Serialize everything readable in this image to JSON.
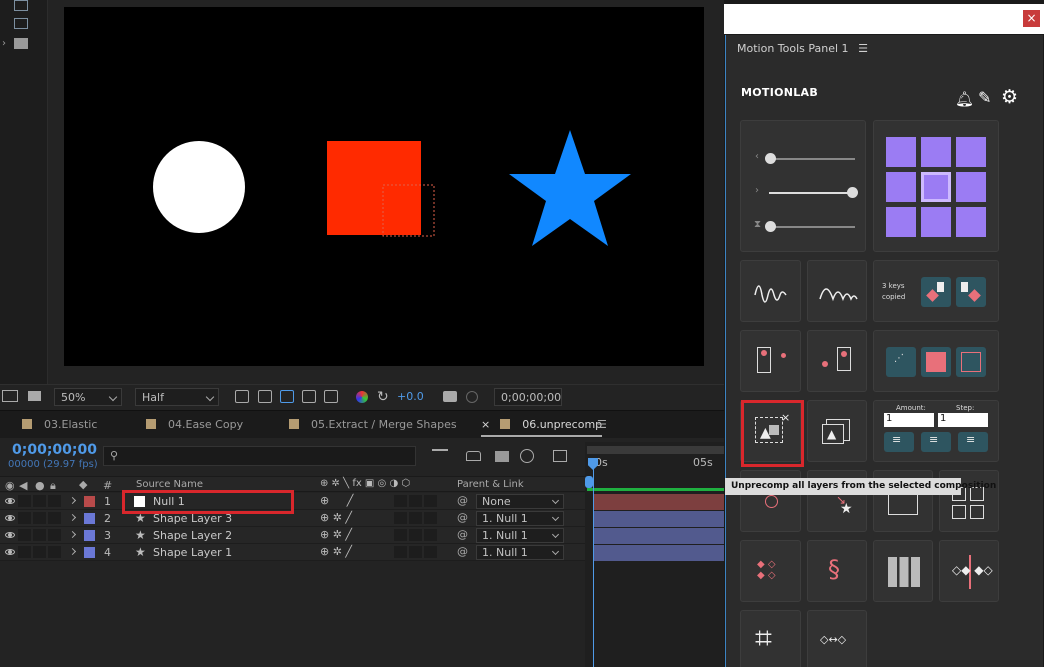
{
  "viewer": {
    "zoom": "50%",
    "resolution": "Half",
    "exposure": "+0.0",
    "timecode": "0;00;00;00"
  },
  "tabs": [
    {
      "label": "03.Elastic"
    },
    {
      "label": "04.Ease Copy"
    },
    {
      "label": "05.Extract / Merge Shapes"
    },
    {
      "label": "06.unprecomp",
      "active": true
    }
  ],
  "timeline": {
    "timecode": "0;00;00;00",
    "frames": "00000 (29.97 fps)",
    "search_placeholder": "",
    "columns": {
      "number": "#",
      "source_name": "Source Name",
      "parent": "Parent & Link"
    },
    "ruler": {
      "start": "0s",
      "end": "05s"
    },
    "layers": [
      {
        "num": "1",
        "name": "Null 1",
        "color": "#b84a4a",
        "parent": "None",
        "type": "null"
      },
      {
        "num": "2",
        "name": "Shape Layer 3",
        "color": "#6b78d6",
        "parent": "1. Null 1",
        "type": "shape"
      },
      {
        "num": "3",
        "name": "Shape Layer 2",
        "color": "#6b78d6",
        "parent": "1. Null 1",
        "type": "shape"
      },
      {
        "num": "4",
        "name": "Shape Layer 1",
        "color": "#6b78d6",
        "parent": "1. Null 1",
        "type": "shape"
      }
    ]
  },
  "panel": {
    "title": "Motion Tools Panel 1",
    "brand": "MOTIONLAB",
    "close_label": "×",
    "keys_copied": "3 keys\ncopied",
    "amount_label": "Amount:",
    "amount_value": "1",
    "step_label": "Step:",
    "step_value": "1",
    "tooltip": "Unprecomp all layers from the selected composition"
  },
  "colors": {
    "circle": "#ffffff",
    "square": "#ff2a00",
    "star": "#1188ff",
    "accent": "#4f9ae8"
  }
}
